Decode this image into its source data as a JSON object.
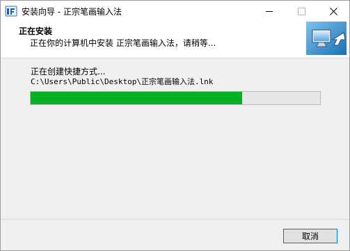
{
  "window": {
    "title": "安装向导 - 正宗笔画输入法"
  },
  "header": {
    "title": "正在安装",
    "subtitle": "正在你的计算机中安装 正宗笔画输入法，请稍等..."
  },
  "progress": {
    "status": "正在创建快捷方式...",
    "path": "C:\\Users\\Public\\Desktop\\正宗笔画输入法.lnk",
    "percent": 73
  },
  "footer": {
    "cancel_label": "取消"
  },
  "colors": {
    "progress_fill": "#06b025",
    "button_border": "#0078d7"
  },
  "icons": {
    "app": "installer-icon",
    "header": "computer-arrow-icon"
  }
}
